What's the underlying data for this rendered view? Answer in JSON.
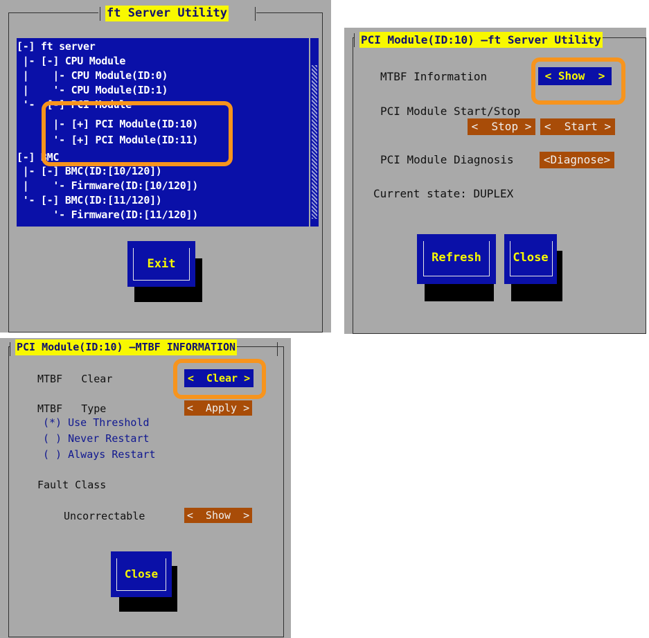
{
  "main_window": {
    "title": "ft Server Utility",
    "tree": [
      "[-] ft server",
      " |- [-] CPU Module",
      " |    |- CPU Module(ID:0)",
      " |    '- CPU Module(ID:1)",
      " '-  [-] PCI Module",
      "      |- [+] PCI Module(ID:10)",
      "      '- [+] PCI Module(ID:11)",
      "[-] BMC",
      " |- [-] BMC(ID:[10/120])",
      " |    '- Firmware(ID:[10/120])",
      " '- [-] BMC(ID:[11/120])",
      "      '- Firmware(ID:[11/120])"
    ],
    "exit_label": "Exit"
  },
  "pci_window": {
    "title": "PCI Module(ID:10) —ft Server Utility",
    "mtbf_info_label": "MTBF Information",
    "show_label": "< Show  >",
    "start_stop_label": "PCI Module Start/Stop",
    "stop_label": "<  Stop >",
    "start_label": "<  Start >",
    "diagnosis_label": "PCI Module Diagnosis",
    "diagnose_label": "<Diagnose>",
    "state_label": "Current state: DUPLEX",
    "refresh_label": "Refresh",
    "close_label": "Close"
  },
  "mtbf_window": {
    "title": "PCI Module(ID:10) —MTBF INFORMATION",
    "clear_label": "MTBF   Clear",
    "clear_button": "<  Clear >",
    "type_label": "MTBF   Type",
    "apply_button": "<  Apply >",
    "options": [
      "(*) Use Threshold",
      "( ) Never Restart",
      "( ) Always Restart"
    ],
    "fault_class_label": "Fault Class",
    "uncorrectable_label": "Uncorrectable",
    "show_button": "<  Show  >",
    "close_label": "Close"
  },
  "colors": {
    "panel_bg": "#a9a9a9",
    "dialog_blue": "#0a10a8",
    "title_yellow": "#f8f800",
    "action_orange": "#a84c08",
    "highlight_orange": "#f7941d"
  }
}
